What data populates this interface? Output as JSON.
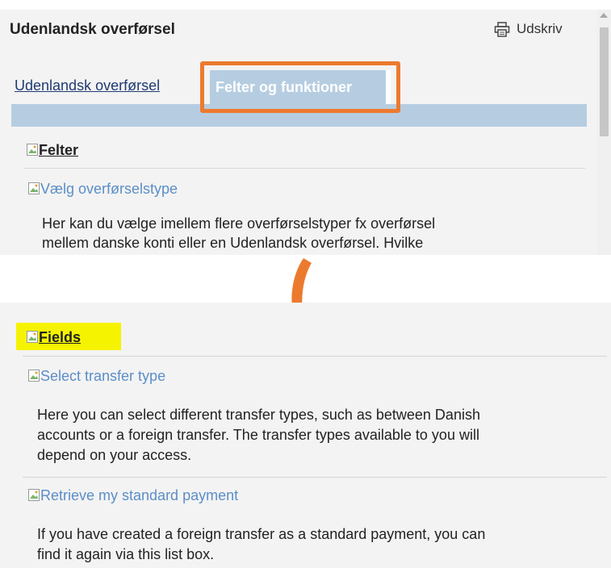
{
  "top": {
    "title": "Udenlandsk overførsel",
    "print_label": "Udskriv",
    "tabs": [
      {
        "label": "Udenlandsk overførsel",
        "active": false
      },
      {
        "label": "Felter og funktioner",
        "active": true
      }
    ],
    "section_title": "Felter",
    "field_label": "Vælg overførselstype",
    "description_lines": [
      "Her kan du vælge imellem flere overførselstyper fx overførsel",
      "mellem danske konti eller en Udenlandsk overførsel. Hvilke"
    ]
  },
  "bottom": {
    "section_title": "Fields",
    "fields": [
      {
        "label": "Select transfer type",
        "description_lines": [
          "Here you can select different transfer types, such as between Danish",
          "accounts or a foreign transfer. The transfer types available to you will",
          "depend on your access."
        ]
      },
      {
        "label": "Retrieve my standard payment",
        "description_lines": [
          "If you have created a foreign transfer as a standard payment, you can",
          "find it again via this list box."
        ]
      }
    ]
  },
  "colors": {
    "highlight_orange": "#ec7a2e",
    "tab_blue": "#b6cde1",
    "link_blue": "#5b8ec7",
    "highlight_yellow": "#f6f300"
  },
  "icons": [
    "printer-icon",
    "broken-image-icon",
    "arrow-down-icon"
  ]
}
